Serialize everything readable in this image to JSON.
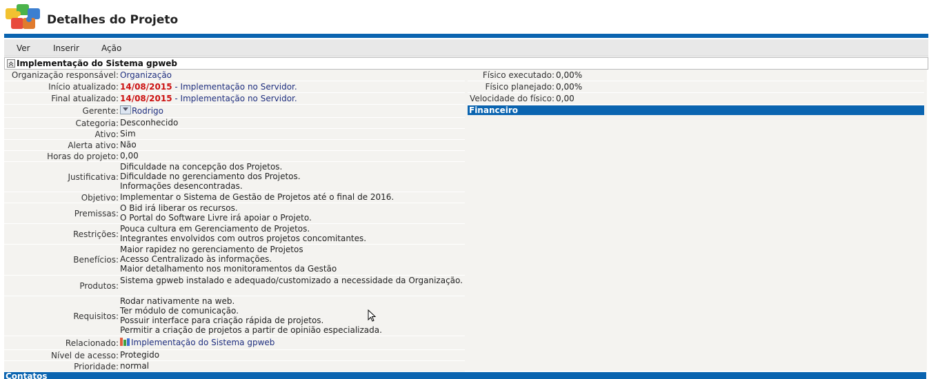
{
  "header": {
    "title": "Detalhes do Projeto"
  },
  "menu": [
    {
      "label": "Ver"
    },
    {
      "label": "Inserir"
    },
    {
      "label": "Ação"
    }
  ],
  "section": {
    "title": "Implementação do Sistema gpweb"
  },
  "left": {
    "org_label": "Organização responsável:",
    "org_value": "Organização",
    "inicio_label": "Início atualizado:",
    "inicio_date": "14/08/2015",
    "inicio_desc": "- Implementação no Servidor.",
    "final_label": "Final atualizado:",
    "final_date": "14/08/2015",
    "final_desc": "- Implementação no Servidor.",
    "gerente_label": "Gerente:",
    "gerente_value": "Rodrigo",
    "categoria_label": "Categoria:",
    "categoria_value": "Desconhecido",
    "ativo_label": "Ativo:",
    "ativo_value": "Sim",
    "alerta_label": "Alerta ativo:",
    "alerta_value": "Não",
    "horas_label": "Horas do projeto:",
    "horas_value": "0,00",
    "justificativa_label": "Justificativa:",
    "justificativa_lines": [
      "Dificuldade na concepção dos Projetos.",
      "Dificuldade no gerenciamento dos Projetos.",
      "Informações desencontradas."
    ],
    "objetivo_label": "Objetivo:",
    "objetivo_value": "Implementar o Sistema de Gestão de Projetos até o final de 2016.",
    "premissas_label": "Premissas:",
    "premissas_lines": [
      "O Bid irá liberar os recursos.",
      "O Portal do Software Livre irá apoiar o Projeto."
    ],
    "restricoes_label": "Restrições:",
    "restricoes_lines": [
      "Pouca cultura em Gerenciamento de Projetos.",
      "Integrantes  envolvidos com outros projetos concomitantes."
    ],
    "beneficios_label": "Benefícios:",
    "beneficios_lines": [
      "Maior rapidez no gerenciamento de Projetos",
      "Acesso Centralizado às informações.",
      "Maior detalhamento nos monitoramentos da Gestão"
    ],
    "produtos_label": "Produtos:",
    "produtos_value": "Sistema gpweb instalado e adequado/customizado a necessidade da Organização.",
    "requisitos_label": "Requisitos:",
    "requisitos_lines": [
      "Rodar nativamente na web.",
      "Ter módulo de comunicação.",
      "Possuir interface para criação rápida de projetos.",
      "Permitir a criação de projetos a partir de opinião especializada."
    ],
    "relacionado_label": "Relacionado:",
    "relacionado_value": "Implementação do Sistema gpweb",
    "nivel_label": "Nível de acesso:",
    "nivel_value": "Protegido",
    "prioridade_label": "Prioridade:",
    "prioridade_value": "normal"
  },
  "right": {
    "fisico_exec_label": "Físico executado:",
    "fisico_exec_value": "0,00%",
    "fisico_plan_label": "Físico planejado:",
    "fisico_plan_value": "0,00%",
    "velocidade_label": "Velocidade do físico:",
    "velocidade_value": "0,00",
    "financeiro_title": "Financeiro"
  },
  "contatos_title": "Contatos",
  "colors": {
    "brand_blue": "#0a64b0",
    "date_red": "#cc1111",
    "link_blue": "#1f2f7f"
  },
  "icons": {
    "logo": "puzzle-logo-icon",
    "collapse": "collapse-up-icon",
    "gerente": "user-dropdown-icon",
    "relacionado": "project-icon"
  }
}
